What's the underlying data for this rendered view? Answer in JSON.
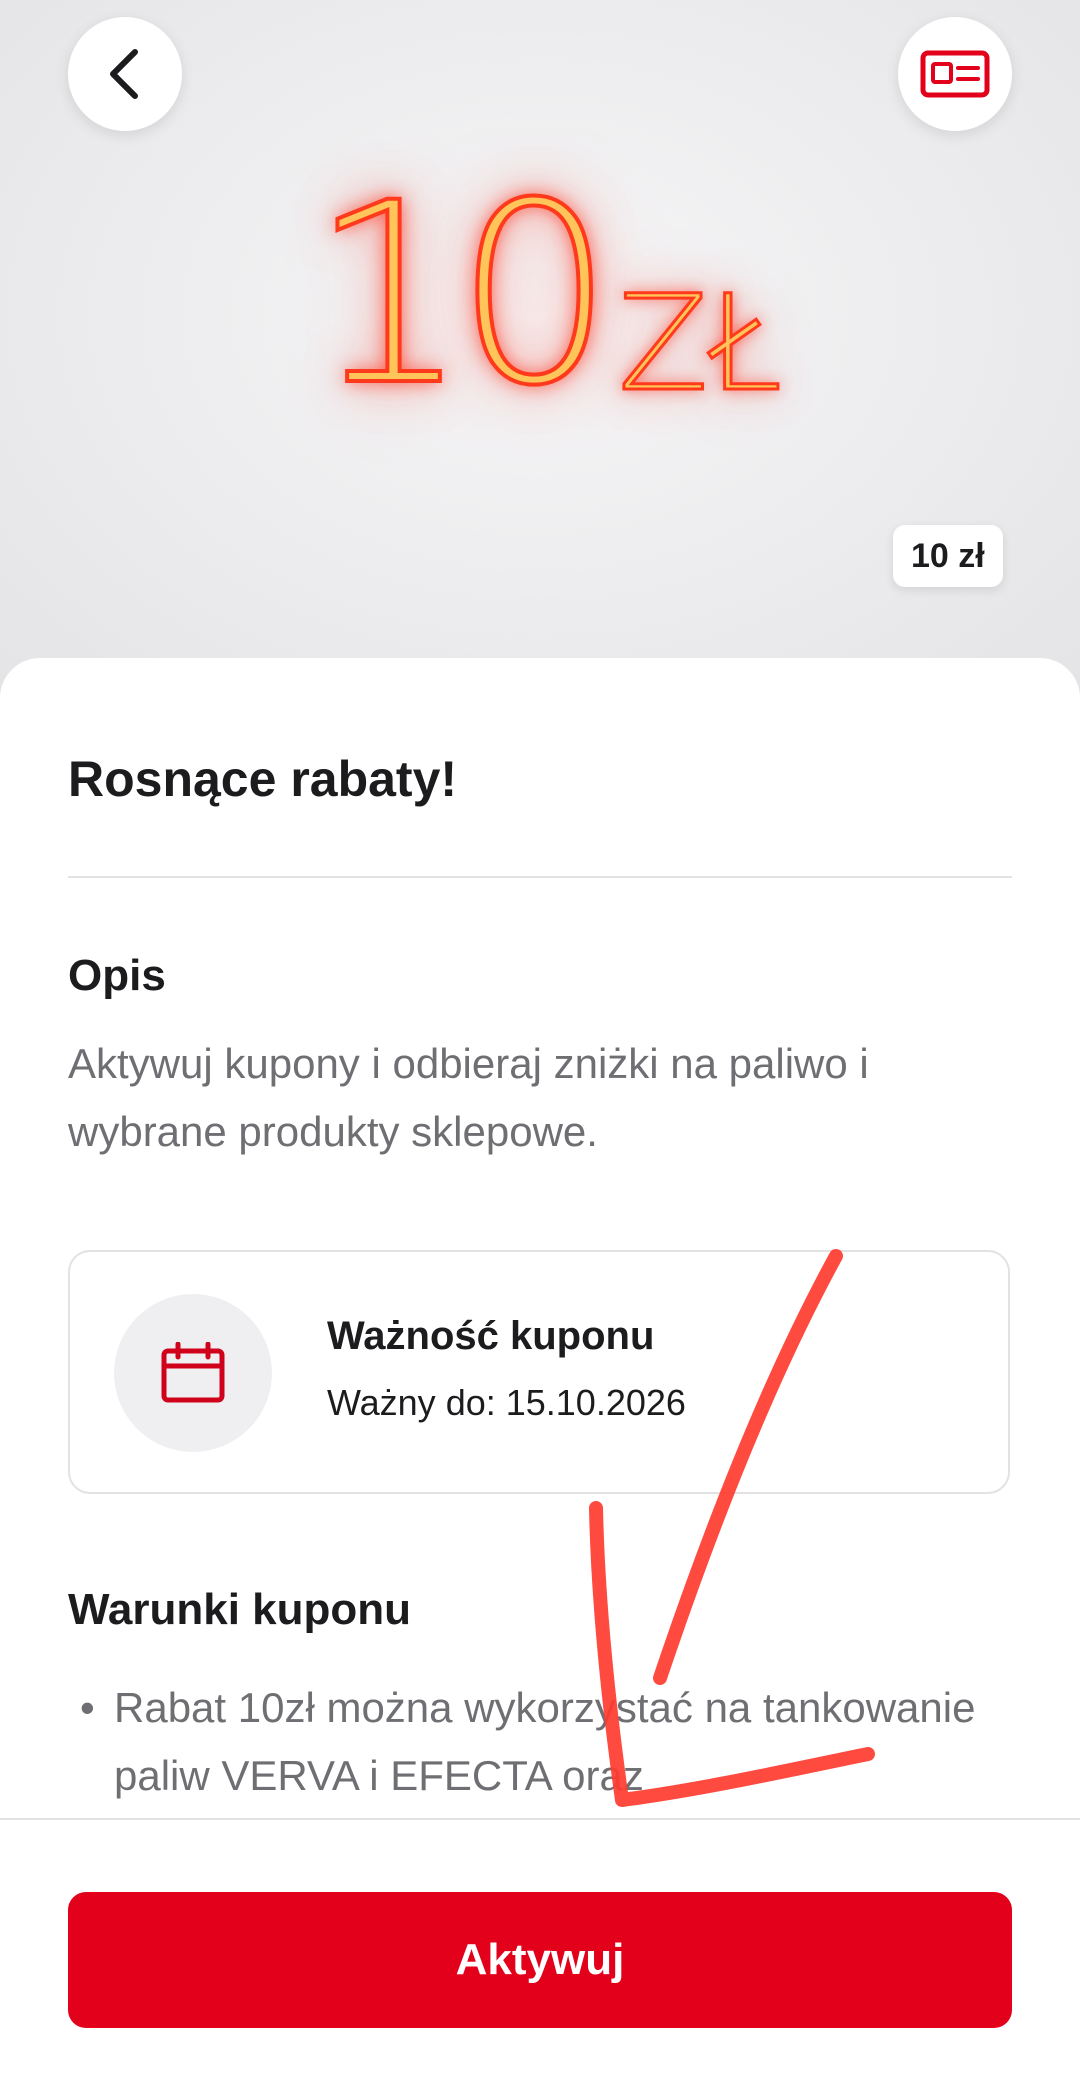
{
  "hero": {
    "back_icon": "chevron-left-icon",
    "card_icon": "id-card-icon",
    "amount_big": "10",
    "currency_big": "ZŁ",
    "badge": "10 zł",
    "accent_color": "#e3001b"
  },
  "coupon": {
    "title": "Rosnące rabaty!",
    "description_heading": "Opis",
    "description": "Aktywuj kupony i odbieraj zniżki na paliwo i wybrane produkty sklepowe.",
    "validity": {
      "icon": "calendar-icon",
      "title": "Ważność kuponu",
      "date": "Ważny do: 15.10.2026"
    },
    "conditions_heading": "Warunki kuponu",
    "conditions": [
      "Rabat 10zł można wykorzystać na tankowanie paliw VERVA i EFECTA oraz"
    ]
  },
  "footer": {
    "activate_label": "Aktywuj"
  }
}
